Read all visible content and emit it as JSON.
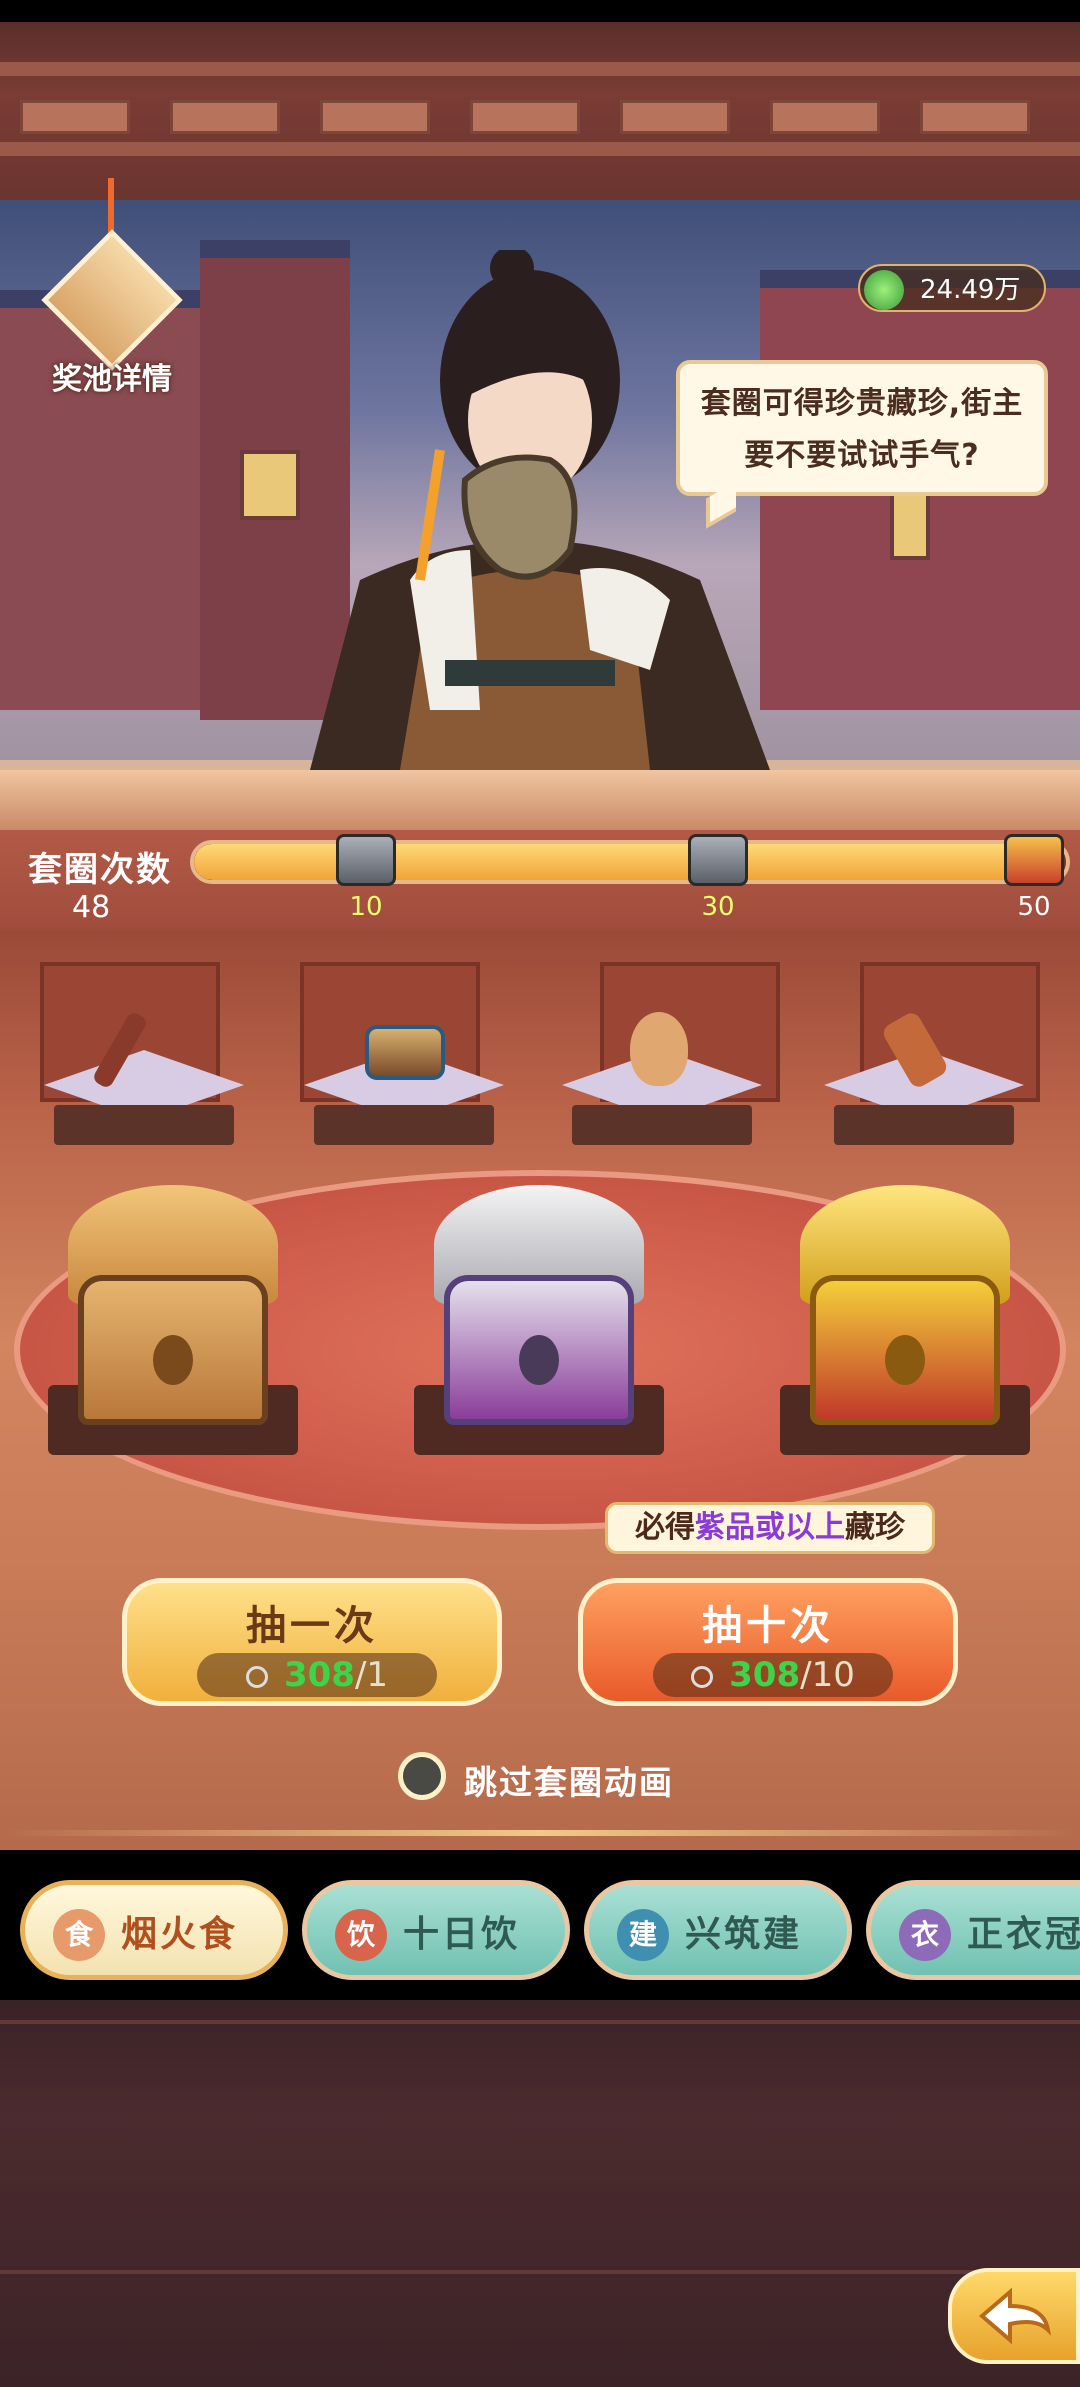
{
  "header": {
    "pool_details_label": "奖池详情",
    "currency_amount": "24.49万",
    "npc_speech": "套圈可得珍贵藏珍,街主要不要试试手气?"
  },
  "progress": {
    "label": "套圈次数",
    "current_count": "48",
    "max": 50,
    "value": 48,
    "milestones": [
      {
        "value": "10",
        "chest": "silver"
      },
      {
        "value": "30",
        "chest": "silver"
      },
      {
        "value": "50",
        "chest": "gold"
      }
    ]
  },
  "prizes": {
    "items": [
      {
        "name": "erhu-icon"
      },
      {
        "name": "drum-icon"
      },
      {
        "name": "ocarina-icon"
      },
      {
        "name": "horn-icon"
      }
    ],
    "chests": [
      {
        "name": "bronze-crane-chest"
      },
      {
        "name": "silver-crane-chest"
      },
      {
        "name": "gold-crane-chest"
      }
    ],
    "guarantee_prefix": "必得",
    "guarantee_highlight": "紫品或以上",
    "guarantee_suffix": "藏珍"
  },
  "actions": {
    "draw_one": {
      "label": "抽一次",
      "owned": "308",
      "cost": "/1"
    },
    "draw_ten": {
      "label": "抽十次",
      "owned": "308",
      "cost": "/10"
    },
    "skip_animation_label": "跳过套圈动画"
  },
  "tabs": [
    {
      "icon": "食",
      "label": "烟火食",
      "selected": true,
      "icon_color": "#e79a6b"
    },
    {
      "icon": "饮",
      "label": "十日饮",
      "selected": false,
      "icon_color": "#d9644c"
    },
    {
      "icon": "建",
      "label": "兴筑建",
      "selected": false,
      "icon_color": "#3f8fb0"
    },
    {
      "icon": "衣",
      "label": "正衣冠",
      "selected": false,
      "icon_color": "#8e6bb8"
    }
  ],
  "colors": {
    "accent_orange": "#f06a2c",
    "progress_fill": "#f0a438",
    "green_count": "#3ed44a",
    "purple_text": "#8a3bd6"
  }
}
